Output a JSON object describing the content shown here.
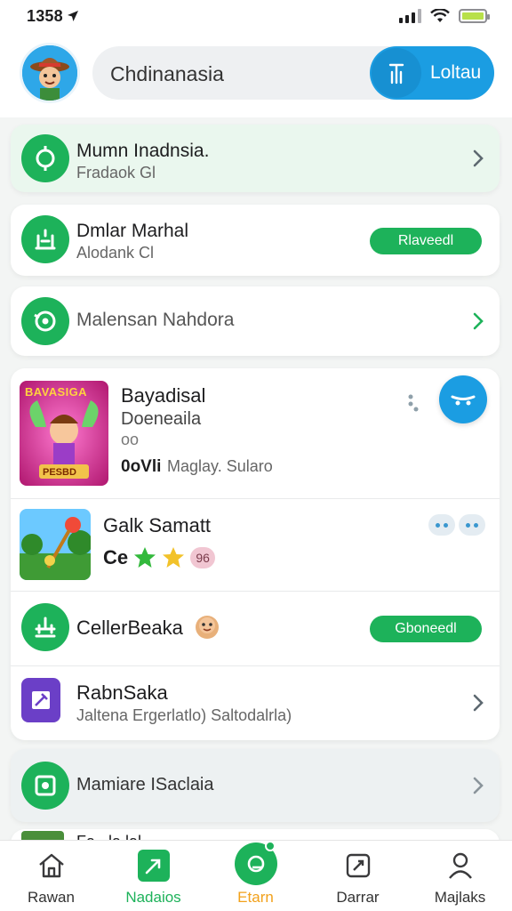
{
  "status": {
    "time": "1358"
  },
  "header": {
    "search_text": "Chdinanasia",
    "search_button": "Loltau"
  },
  "colors": {
    "green": "#1db25a",
    "blue": "#1b9de2",
    "orange": "#f2a11b"
  },
  "rows": [
    {
      "title": "Mumn Inadnsia.",
      "subtitle": "Fradaok Gl",
      "icon": "target-icon"
    },
    {
      "title": "Dmlar Marhal",
      "subtitle": "Alodank Cl",
      "action": "Rlaveedl",
      "icon": "bank-icon"
    },
    {
      "title": "Malensan Nahdora",
      "icon": "radar-icon"
    }
  ],
  "games": [
    {
      "art_text": "BAVASIGA",
      "art_badge": "PESBD",
      "title": "Bayadisal",
      "subtitle": "Doeneaila",
      "meta_icon": "oo",
      "meta_left": "0oVli",
      "meta_right": "Maglay. Sularo"
    },
    {
      "title": "Galk Samatt",
      "meta_left": "Ce",
      "badge": "96"
    }
  ],
  "list": [
    {
      "title": "CellerBeaka",
      "action": "Gboneedl",
      "icon": "bank-icon"
    },
    {
      "title": "RabnSaka",
      "subtitle": "Jaltena Ergerlatlo) Saltodalrla)",
      "icon": "edit-icon"
    },
    {
      "title": "Mamiare ISaclaia",
      "icon": "frame-icon"
    }
  ],
  "peek": {
    "title": "Fa...la lal"
  },
  "nav": [
    {
      "label": "Rawan",
      "icon": "home-icon"
    },
    {
      "label": "Nadaios",
      "icon": "leaf-icon",
      "active": true
    },
    {
      "label": "Etarn",
      "icon": "shop-icon",
      "center": true
    },
    {
      "label": "Darrar",
      "icon": "tag-icon"
    },
    {
      "label": "Majlaks",
      "icon": "profile-icon"
    }
  ]
}
